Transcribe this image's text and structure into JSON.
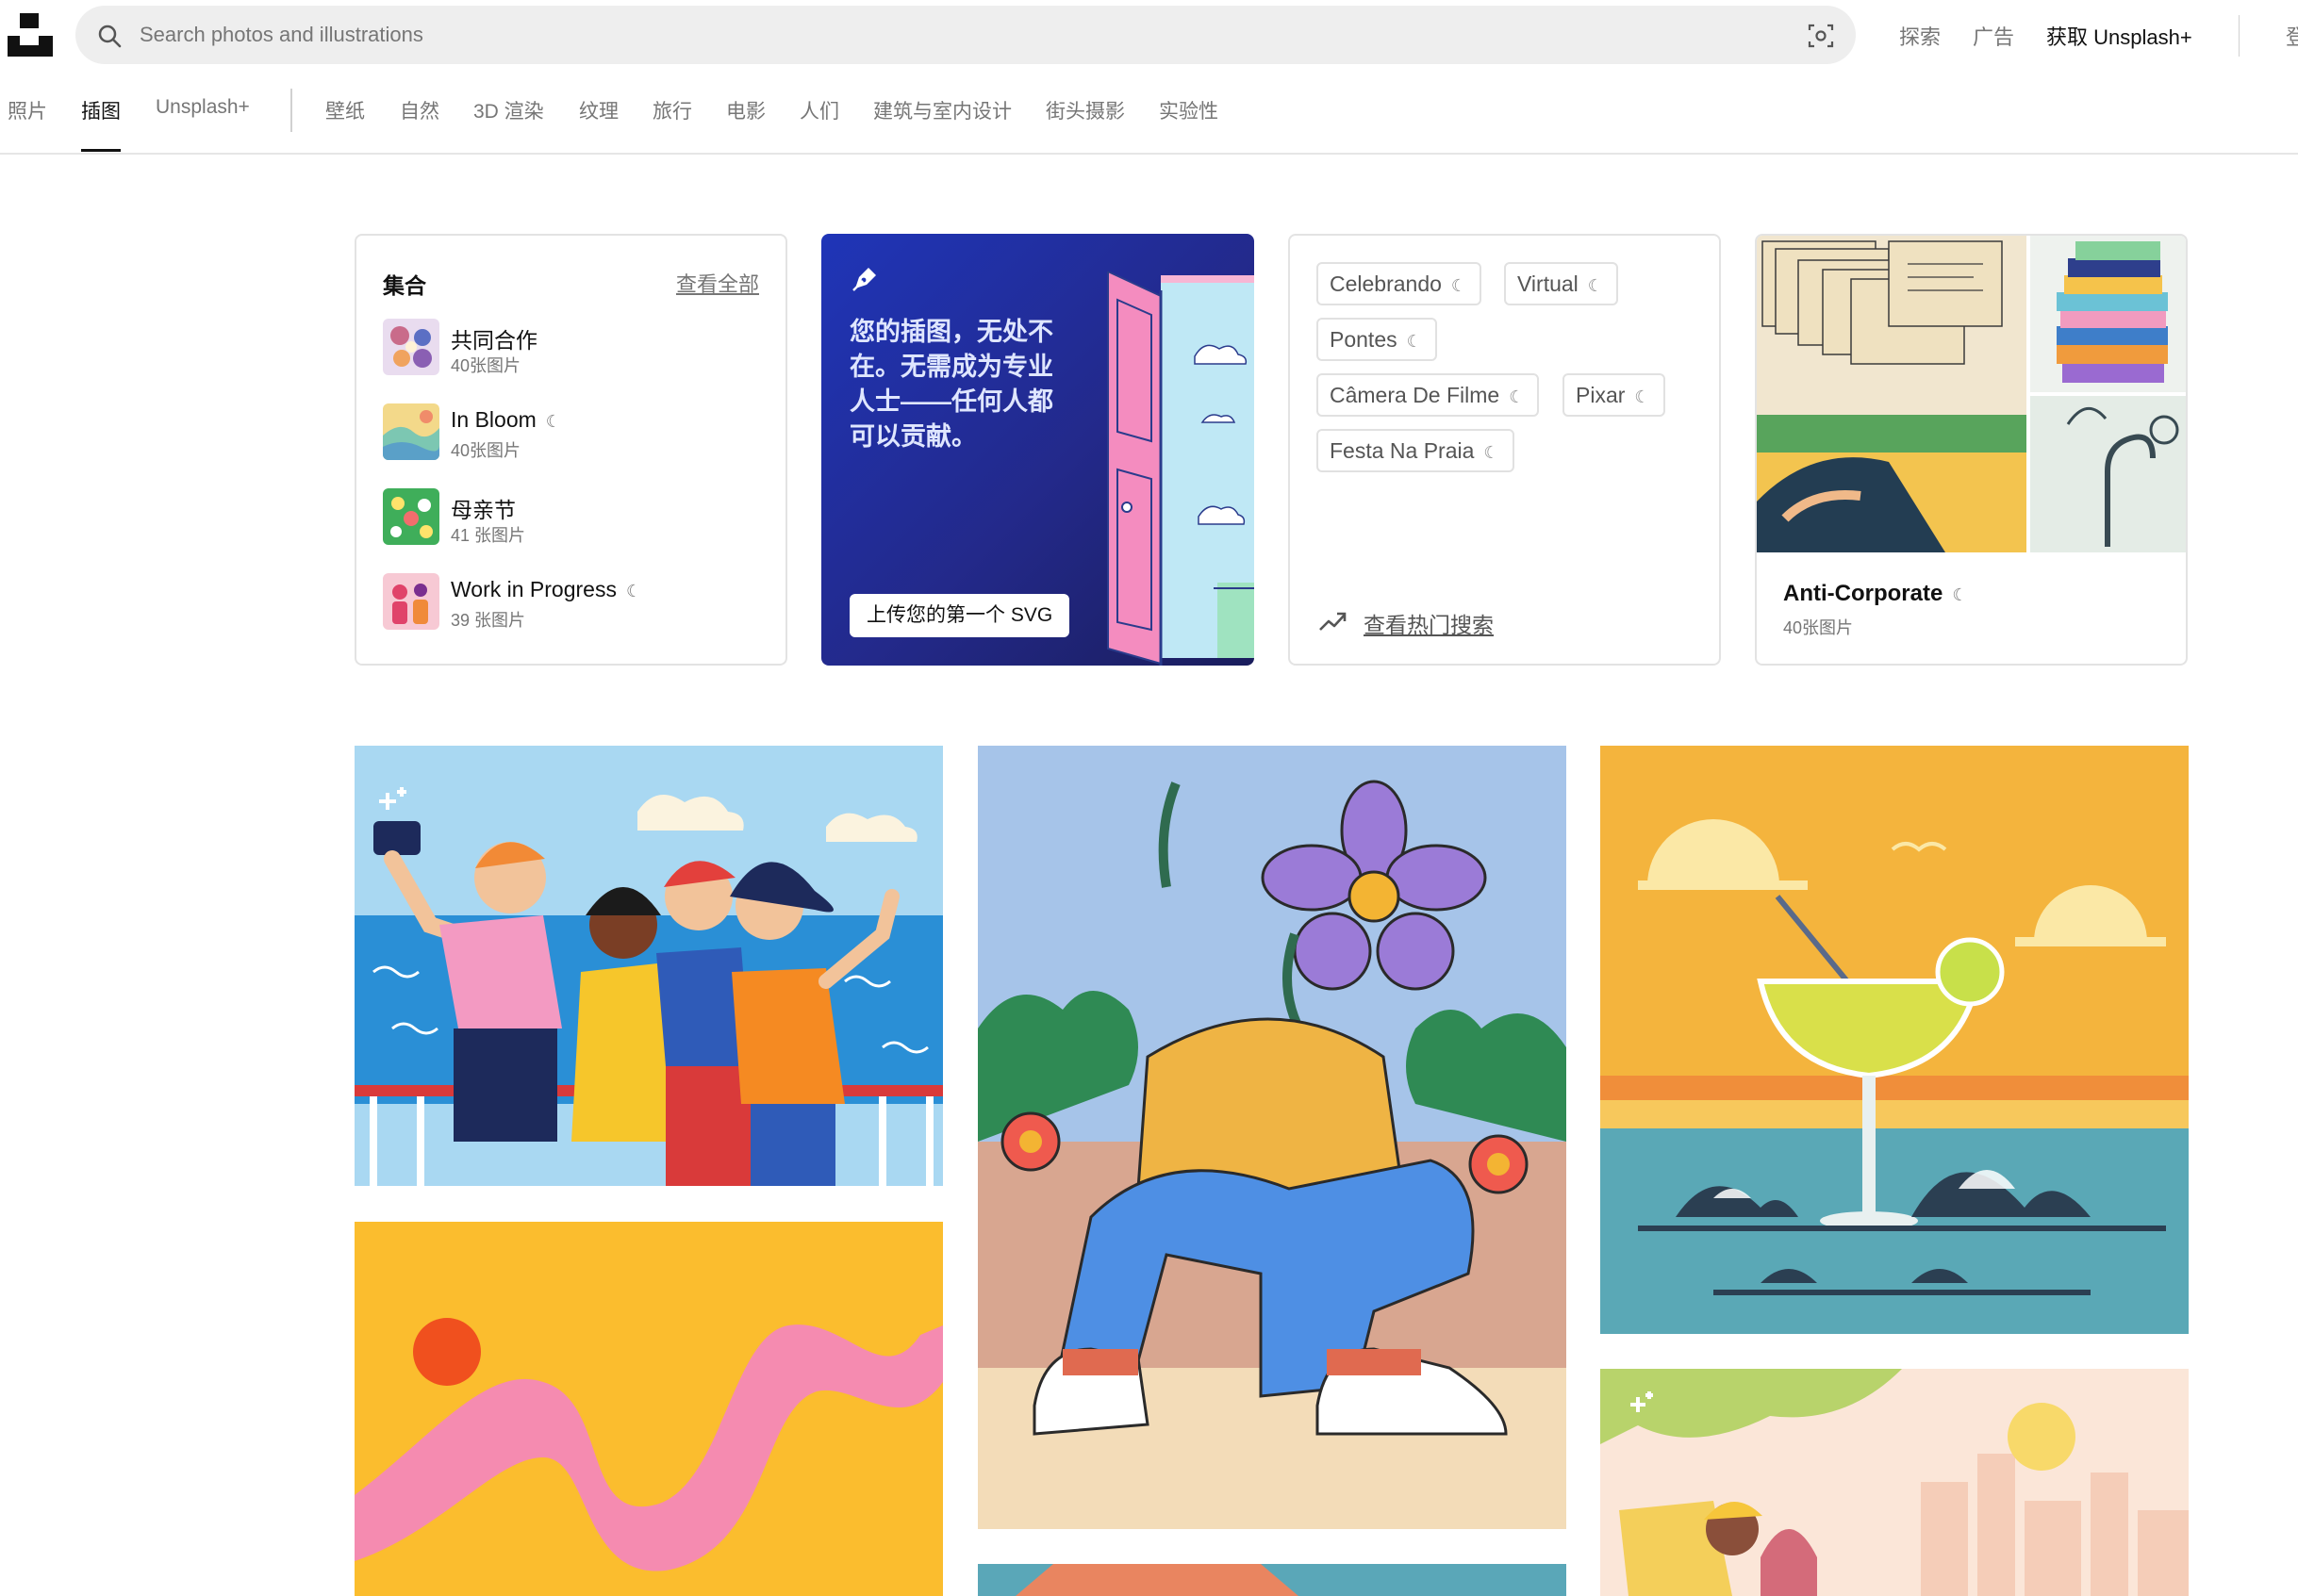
{
  "header": {
    "search_placeholder": "Search photos and illustrations",
    "nav": {
      "explore": "探索",
      "advertise": "广告",
      "get_plus": "获取 Unsplash+"
    },
    "cut_off_text": "登"
  },
  "tabs": {
    "items": [
      "照片",
      "插图",
      "Unsplash+",
      "壁纸",
      "自然",
      "3D 渲染",
      "纹理",
      "旅行",
      "电影",
      "人们",
      "建筑与室内设计",
      "街头摄影",
      "实验性"
    ],
    "active": "插图"
  },
  "collections": {
    "title": "集合",
    "view_all": "查看全部",
    "items": [
      {
        "name": "共同合作",
        "count": "40张图片",
        "plus": false
      },
      {
        "name": "In Bloom",
        "count": "40张图片",
        "plus": true
      },
      {
        "name": "母亲节",
        "count": "41 张图片",
        "plus": false
      },
      {
        "name": "Work in Progress",
        "count": "39 张图片",
        "plus": true
      }
    ]
  },
  "promo": {
    "text": "您的插图，无处不在。无需成为专业人士——任何人都可以贡献。",
    "button": "上传您的第一个 SVG"
  },
  "trending": {
    "chips": [
      "Celebrando",
      "Virtual",
      "Pontes",
      "Câmera De Filme",
      "Pixar",
      "Festa Na Praia"
    ],
    "link": "查看热门搜索"
  },
  "featured": {
    "title": "Anti-Corporate",
    "count": "40张图片"
  },
  "plus_mark": "☾",
  "colors": {
    "accent": "#111111",
    "muted": "#767676",
    "promo_bg": "#1f35b8",
    "border": "#e3e3e3"
  }
}
